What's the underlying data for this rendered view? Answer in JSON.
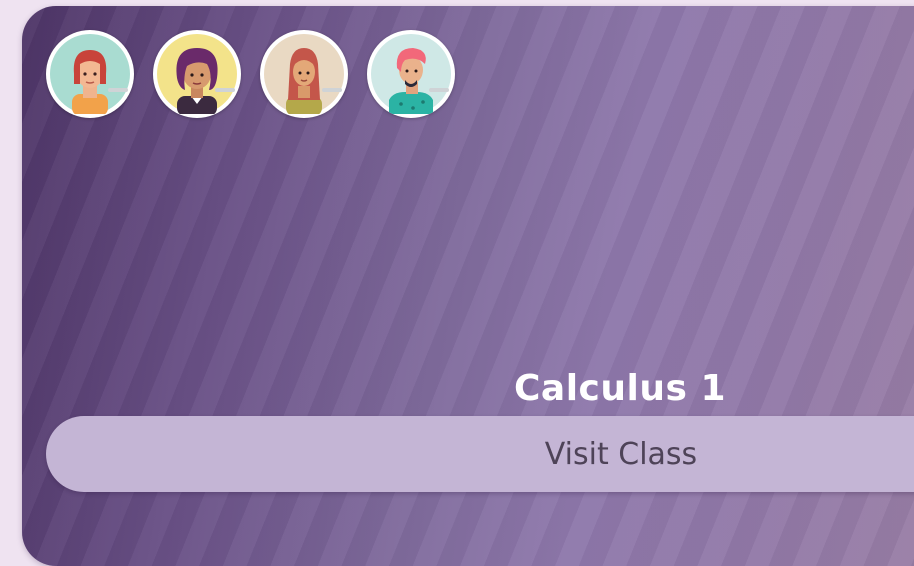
{
  "class_card": {
    "title": "Calculus 1",
    "button_label": "Visit Class",
    "members": [
      {
        "icon": "woman-red-hair-avatar-icon"
      },
      {
        "icon": "woman-curly-hair-avatar-icon"
      },
      {
        "icon": "woman-long-hair-avatar-icon"
      },
      {
        "icon": "man-pink-hair-avatar-icon"
      }
    ]
  },
  "colors": {
    "page_background": "#efe3f1",
    "card_gradient_start": "#4e3567",
    "card_gradient_end": "#9a7fa5",
    "button_background": "#c4b5d5",
    "button_text": "#4e4358",
    "title_text": "#ffffff"
  }
}
